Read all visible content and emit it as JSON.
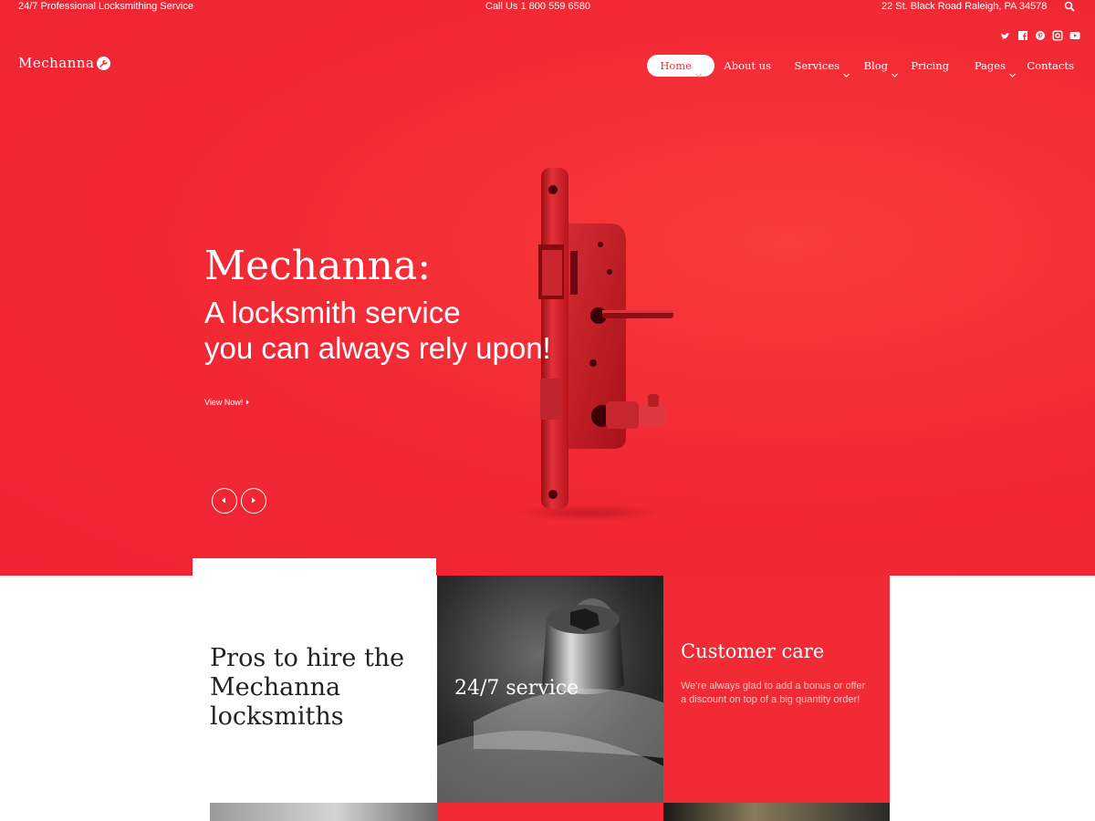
{
  "topbar": {
    "tagline": "24/7 Professional Locksmithing Service",
    "phone": "Call Us 1 800 559 6580",
    "address": "22 St. Black Road Raleigh, PA 34578",
    "search_icon": "search-icon"
  },
  "social": [
    "twitter-icon",
    "facebook-icon",
    "pinterest-icon",
    "instagram-icon",
    "youtube-icon"
  ],
  "brand": {
    "name": "Mechanna",
    "icon": "wrench-icon"
  },
  "nav": {
    "items": [
      {
        "label": "Home",
        "active": true,
        "dropdown": true
      },
      {
        "label": "About us",
        "active": false,
        "dropdown": false
      },
      {
        "label": "Services",
        "active": false,
        "dropdown": true
      },
      {
        "label": "Blog",
        "active": false,
        "dropdown": true
      },
      {
        "label": "Pricing",
        "active": false,
        "dropdown": false
      },
      {
        "label": "Pages",
        "active": false,
        "dropdown": true
      },
      {
        "label": "Contacts",
        "active": false,
        "dropdown": false
      }
    ]
  },
  "hero": {
    "title": "Mechanna:",
    "subtitle_line1": "A locksmith service",
    "subtitle_line2": "you can always rely upon!",
    "cta": "View Now!",
    "prev_icon": "arrow-left-icon",
    "next_icon": "arrow-right-icon"
  },
  "features": {
    "pros_title_line1": "Pros to hire the",
    "pros_title_line2": "Mechanna",
    "pros_title_line3": "locksmiths",
    "service_title": "24/7 service",
    "care_title": "Customer care",
    "care_text": "We're always glad to add a bonus or offer a discount on top of a big quantity order!"
  },
  "colors": {
    "accent": "#f22a35",
    "white": "#ffffff",
    "dark": "#222222"
  }
}
